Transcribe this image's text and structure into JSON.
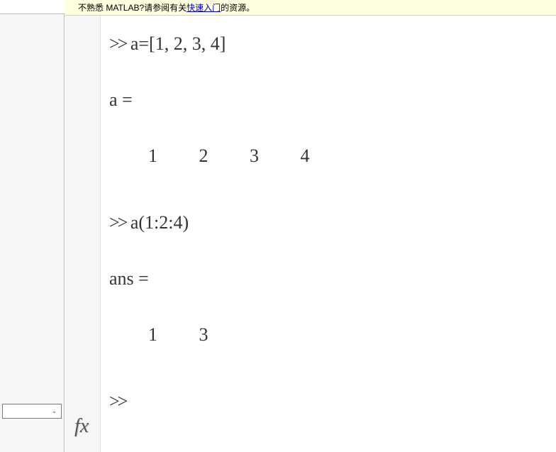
{
  "help_bar": {
    "pre": "不熟悉 MATLAB?请参阅有关",
    "link": "快速入门",
    "post": "的资源。"
  },
  "cmds": {
    "prompt": ">>",
    "cmd1": "a=[1, 2, 3, 4]",
    "out1_label": "a =",
    "out1_values": "1 2 3 4",
    "cmd2": "a(1:2:4)",
    "out2_label": "ans =",
    "out2_values": "1 3"
  },
  "fx_label": "fx"
}
